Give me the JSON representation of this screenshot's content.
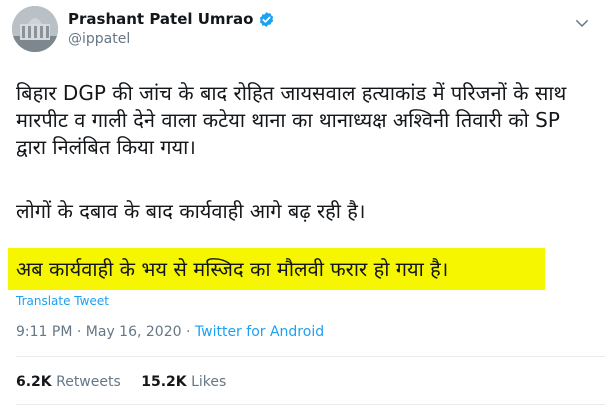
{
  "author": {
    "display_name": "Prashant Patel Umrao",
    "handle": "@ippatel"
  },
  "tweet": {
    "paragraph1": "बिहार DGP की जांच के बाद रोहित जायसवाल हत्याकांड में परिजनों के साथ मारपीट व गाली देने वाला कटेया थाना का थानाध्यक्ष अश्विनी  तिवारी को SP द्वारा निलंबित किया गया।",
    "paragraph2": "लोगों के दबाव के बाद कार्यवाही आगे बढ़ रही है।",
    "paragraph3_highlighted": "अब कार्यवाही के भय से मस्जिद का मौलवी फरार हो गया है।",
    "translate_label": "Translate Tweet",
    "time": "9:11 PM",
    "date": "May 16, 2020",
    "source": "Twitter for Android"
  },
  "stats": {
    "retweets_count": "6.2K",
    "retweets_label": "Retweets",
    "likes_count": "15.2K",
    "likes_label": "Likes"
  },
  "colors": {
    "highlight": "#f6f600",
    "link": "#1da1f2",
    "muted": "#657786"
  },
  "icons": {
    "verified": "verified-badge-icon",
    "menu": "chevron-down-icon"
  }
}
